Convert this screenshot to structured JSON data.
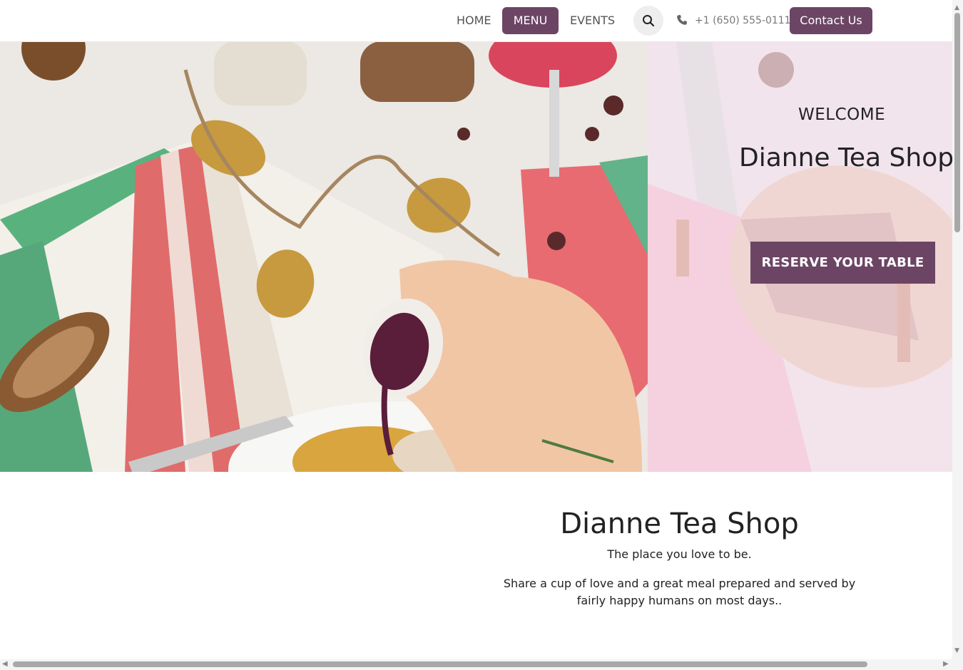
{
  "nav": {
    "items": [
      {
        "label": "HOME"
      },
      {
        "label": "MENU"
      },
      {
        "label": "EVENTS"
      }
    ],
    "phone": "+1 (650) 555-0111",
    "contact_label": "Contact Us",
    "search_icon": "search-icon",
    "phone_icon": "phone-icon"
  },
  "hero": {
    "welcome": "WELCOME",
    "title": "Dianne Tea Shop",
    "cta_label": "RESERVE YOUR TABLE"
  },
  "about": {
    "title": "Dianne Tea Shop",
    "tagline": "The place you love to be.",
    "description": "Share a cup of love and a great meal prepared and served by fairly happy humans on most days.."
  },
  "colors": {
    "accent": "#6c4565",
    "hero_overlay": "#f5e1f0"
  }
}
